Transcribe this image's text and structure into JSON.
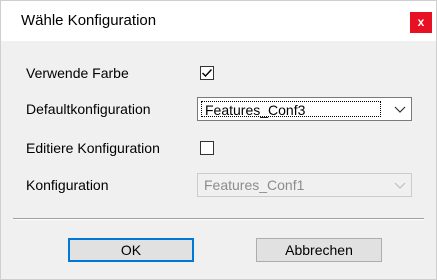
{
  "window": {
    "title": "Wähle Konfiguration",
    "close_glyph": "x"
  },
  "form": {
    "use_color": {
      "label": "Verwende Farbe",
      "checked": true
    },
    "default_config": {
      "label": "Defaultkonfiguration",
      "value": "Features_Conf3",
      "enabled": true
    },
    "edit_config": {
      "label": "Editiere Konfiguration",
      "checked": false
    },
    "config": {
      "label": "Konfiguration",
      "value": "Features_Conf1",
      "enabled": false
    }
  },
  "buttons": {
    "ok_label": "OK",
    "cancel_label": "Abbrechen"
  },
  "colors": {
    "close_button": "#e81123",
    "default_button_border": "#0078d7",
    "dialog_background": "#f0f0f0",
    "disabled_text": "#8c8c8c"
  },
  "icons": {
    "close": "close-icon",
    "checkmark": "checkmark-icon",
    "dropdown": "chevron-down-icon"
  }
}
